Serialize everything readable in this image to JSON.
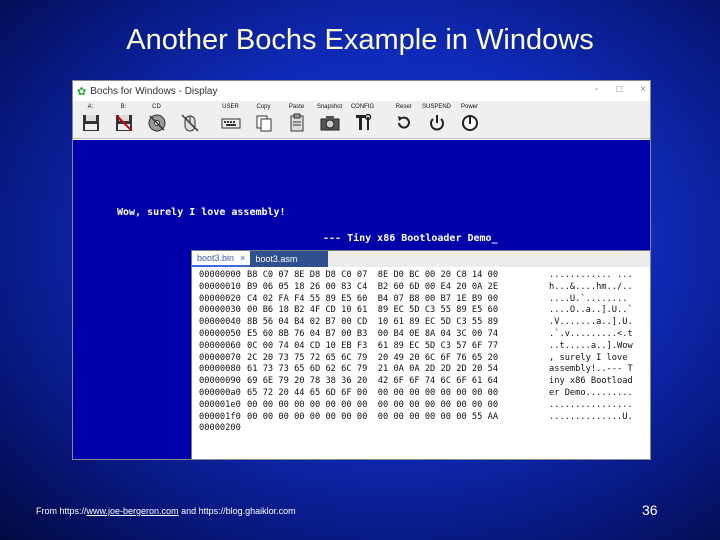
{
  "slide": {
    "title": "Another Bochs Example in Windows",
    "footer_prefix": "From https://",
    "footer_link": "www.joe-bergeron.com",
    "footer_suffix": " and https://blog.ghaiklor.com",
    "page_number": "36"
  },
  "window": {
    "title": "Bochs for Windows - Display",
    "controls": [
      "-",
      "□",
      "×"
    ]
  },
  "toolbar": {
    "buttons": [
      {
        "label": "A:",
        "icon": "floppy-a-icon"
      },
      {
        "label": "B:",
        "icon": "floppy-b-icon"
      },
      {
        "label": "CD",
        "icon": "cdrom-icon"
      },
      {
        "label": "",
        "icon": "mouse-icon"
      },
      {
        "label": "USER",
        "icon": "keyboard-icon"
      },
      {
        "label": "Copy",
        "icon": "copy-icon"
      },
      {
        "label": "Paste",
        "icon": "paste-icon"
      },
      {
        "label": "Snapshot",
        "icon": "camera-icon"
      },
      {
        "label": "CONFIG",
        "icon": "config-icon"
      },
      {
        "label": "Reset",
        "icon": "reset-icon"
      },
      {
        "label": "SUSPEND",
        "icon": "suspend-icon"
      },
      {
        "label": "Power",
        "icon": "power-icon"
      }
    ]
  },
  "display": {
    "line1": "Wow, surely I love assembly!",
    "line2": "--- Tiny x86 Bootloader Demo_"
  },
  "hex_editor": {
    "tabs": [
      {
        "label": "boot3.bin",
        "close": "×"
      },
      {
        "label": "boot3.asm"
      }
    ],
    "rows": [
      {
        "addr": "00000000",
        "bytes": "B8 C0 07 8E D8 D8 C0 07  8E D0 BC 00 20 C8 14 00",
        "ascii": "............ ..."
      },
      {
        "addr": "00000010",
        "bytes": "B9 06 05 18 26 00 83 C4  B2 60 6D 00 E4 20 0A 2E",
        "ascii": "h...&....hm../.."
      },
      {
        "addr": "00000020",
        "bytes": "C4 02 FA F4 55 89 E5 60  B4 07 B8 00 B7 1E B9 00",
        "ascii": "....U.`........"
      },
      {
        "addr": "00000030",
        "bytes": "00 B6 18 B2 4F CD 10 61  89 EC 5D C3 55 89 E5 60",
        "ascii": "....O..a..].U..`"
      },
      {
        "addr": "00000040",
        "bytes": "8B 56 04 B4 02 B7 00 CD  10 61 89 EC 5D C3 55 89",
        "ascii": ".V.......a..].U."
      },
      {
        "addr": "00000050",
        "bytes": "E5 60 8B 76 04 B7 00 B3  00 B4 0E 8A 04 3C 00 74",
        "ascii": ".`.v.........<.t"
      },
      {
        "addr": "00000060",
        "bytes": "0C 00 74 04 CD 10 EB F3  61 89 EC 5D C3 57 6F 77",
        "ascii": "..t.....a..].Wow"
      },
      {
        "addr": "00000070",
        "bytes": "2C 20 73 75 72 65 6C 79  20 49 20 6C 6F 76 65 20",
        "ascii": ", surely I love "
      },
      {
        "addr": "00000080",
        "bytes": "61 73 73 65 6D 62 6C 79  21 0A 0A 2D 2D 2D 20 54",
        "ascii": "assembly!..--- T"
      },
      {
        "addr": "00000090",
        "bytes": "69 6E 79 20 78 38 36 20  42 6F 6F 74 6C 6F 61 64",
        "ascii": "iny x86 Bootload"
      },
      {
        "addr": "000000a0",
        "bytes": "65 72 20 44 65 6D 6F 00  00 00 00 00 00 00 00 00",
        "ascii": "er Demo........."
      },
      {
        "addr": "000001e0",
        "bytes": "00 00 00 00 00 00 00 00  00 00 00 00 00 00 00 00",
        "ascii": "................"
      },
      {
        "addr": "000001f0",
        "bytes": "00 00 00 00 00 00 00 00  00 00 00 00 00 00 55 AA",
        "ascii": "..............U."
      },
      {
        "addr": "00000200",
        "bytes": "",
        "ascii": ""
      }
    ]
  }
}
